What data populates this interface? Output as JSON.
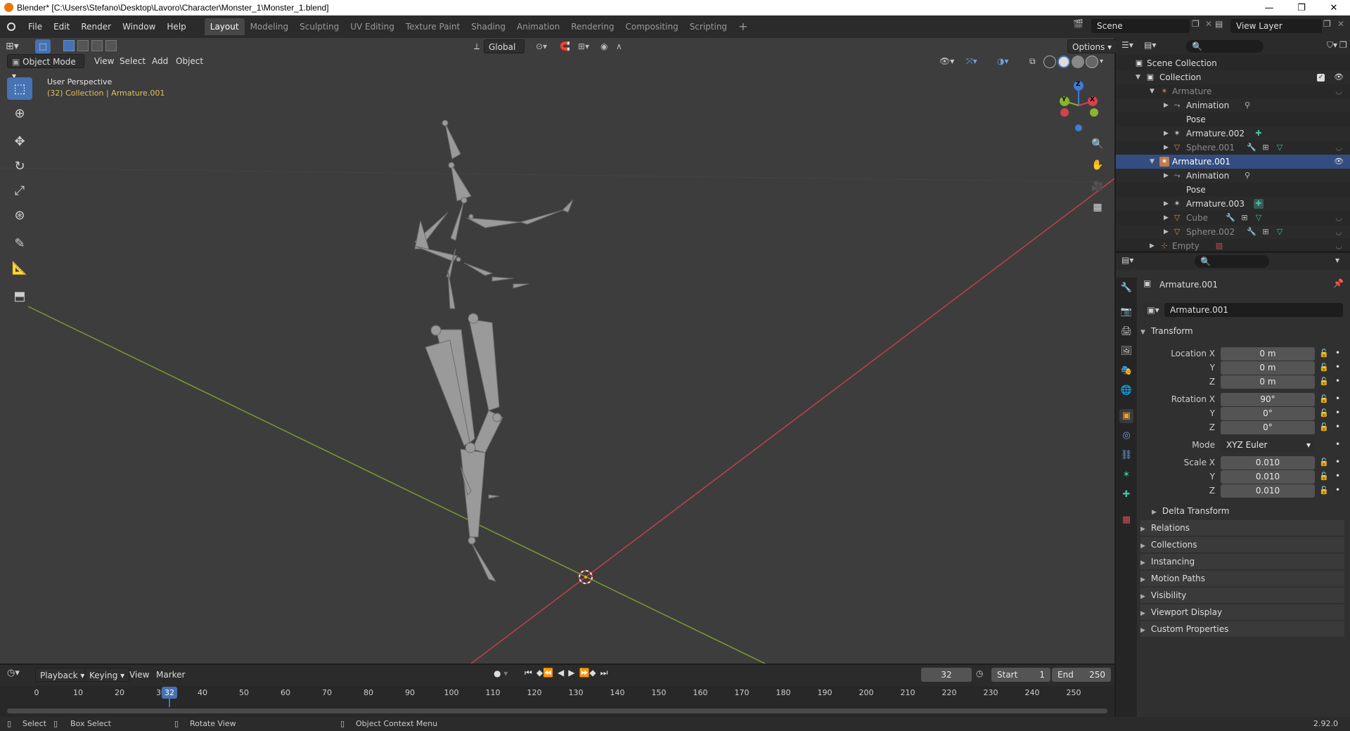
{
  "window": {
    "title": "Blender* [C:\\Users\\Stefano\\Desktop\\Lavoro\\Character\\Monster_1\\Monster_1.blend]",
    "controls": [
      "—",
      "❐",
      "✕"
    ]
  },
  "menubar": {
    "items": [
      "File",
      "Edit",
      "Render",
      "Window",
      "Help"
    ],
    "workspaces": [
      "Layout",
      "Modeling",
      "Sculpting",
      "UV Editing",
      "Texture Paint",
      "Shading",
      "Animation",
      "Rendering",
      "Compositing",
      "Scripting"
    ],
    "active_workspace": "Layout",
    "add_tab": "+",
    "scene": "Scene",
    "view_layer": "View Layer"
  },
  "viewport": {
    "transform_orientation": "Global",
    "options_label": "Options",
    "mode": "Object Mode",
    "menus": [
      "View",
      "Select",
      "Add",
      "Object"
    ],
    "perspective": "User Perspective",
    "collection_info": "(32) Collection | Armature.001",
    "gizmo_axes": {
      "x": "X",
      "y": "Y",
      "z": "Z"
    },
    "colors": {
      "x_axis": "#d6404f",
      "y_axis": "#8ab430",
      "z_axis": "#3f7bd8",
      "text_info": "#e0c060"
    }
  },
  "outliner": {
    "search_placeholder": "",
    "rows": [
      {
        "label": "Scene Collection",
        "icon": "scene-collection-icon"
      },
      {
        "label": "Collection",
        "icon": "collection-icon"
      },
      {
        "label": "Armature",
        "icon": "armature-icon",
        "dim": true
      },
      {
        "label": "Animation",
        "icon": "animation-icon"
      },
      {
        "label": "Pose",
        "icon": "pose-icon"
      },
      {
        "label": "Armature.002",
        "icon": "armature-data-icon"
      },
      {
        "label": "Sphere.001",
        "icon": "mesh-icon",
        "dim": true
      },
      {
        "label": "Armature.001",
        "icon": "armature-icon",
        "selected": true
      },
      {
        "label": "Animation",
        "icon": "animation-icon"
      },
      {
        "label": "Pose",
        "icon": "pose-icon"
      },
      {
        "label": "Armature.003",
        "icon": "armature-data-icon"
      },
      {
        "label": "Cube",
        "icon": "mesh-icon",
        "dim": true
      },
      {
        "label": "Sphere.002",
        "icon": "mesh-icon",
        "dim": true
      },
      {
        "label": "Empty",
        "icon": "empty-icon",
        "dim": true
      }
    ]
  },
  "properties": {
    "object_name": "Armature.001",
    "datablock_name": "Armature.001",
    "transform_header": "Transform",
    "location_label": "Location X",
    "rotation_label": "Rotation X",
    "scale_label": "Scale X",
    "y_label": "Y",
    "z_label": "Z",
    "mode_label": "Mode",
    "location": {
      "x": "0 m",
      "y": "0 m",
      "z": "0 m"
    },
    "rotation": {
      "x": "90°",
      "y": "0°",
      "z": "0°"
    },
    "rotation_mode": "XYZ Euler",
    "scale": {
      "x": "0.010",
      "y": "0.010",
      "z": "0.010"
    },
    "subpanels": [
      "Delta Transform"
    ],
    "panels": [
      "Relations",
      "Collections",
      "Instancing",
      "Motion Paths",
      "Visibility",
      "Viewport Display",
      "Custom Properties"
    ]
  },
  "timeline": {
    "menus": [
      "Playback",
      "Keying",
      "View",
      "Marker"
    ],
    "current_frame": "32",
    "start_label": "Start",
    "start": "1",
    "end_label": "End",
    "end": "250",
    "ticks": [
      "0",
      "10",
      "20",
      "30",
      "40",
      "50",
      "60",
      "70",
      "80",
      "90",
      "100",
      "110",
      "120",
      "130",
      "140",
      "150",
      "160",
      "170",
      "180",
      "190",
      "200",
      "210",
      "220",
      "230",
      "240",
      "250"
    ],
    "playhead_label": "32"
  },
  "statusbar": {
    "items": [
      "Select",
      "Box Select",
      "Rotate View",
      "Object Context Menu"
    ],
    "version": "2.92.0"
  }
}
